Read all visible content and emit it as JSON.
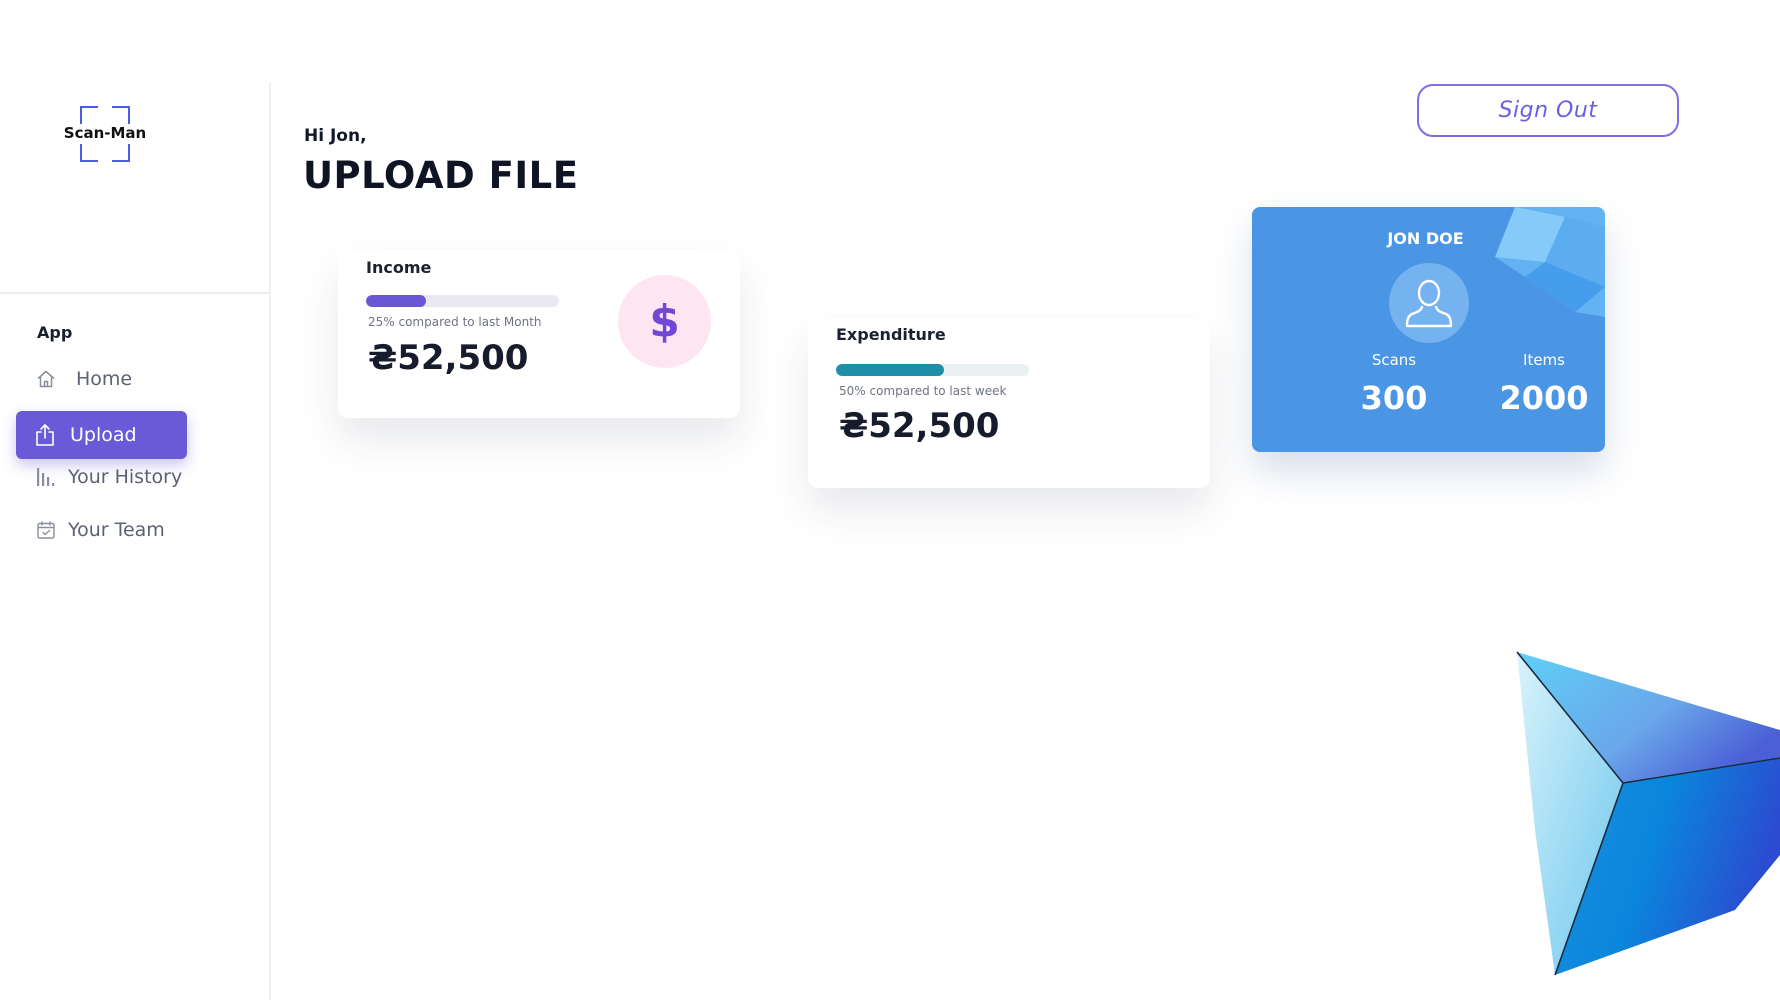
{
  "app": {
    "logo_text": "Scan-Man"
  },
  "sidebar": {
    "section_label": "App",
    "items": [
      {
        "label": "Home",
        "icon": "home-icon",
        "active": false
      },
      {
        "label": "Upload",
        "icon": "upload-icon",
        "active": true
      },
      {
        "label": "Your History",
        "icon": "bar-chart-icon",
        "active": false
      },
      {
        "label": "Your Team",
        "icon": "calendar-check-icon",
        "active": false
      }
    ]
  },
  "header": {
    "greeting": "Hi Jon,",
    "title": "UPLOAD FILE",
    "signout_label": "Sign Out"
  },
  "cards": {
    "income": {
      "title": "Income",
      "progress_percent": 25,
      "comparison": "25% compared to last  Month",
      "amount": "₴52,500",
      "icon": "dollar-icon"
    },
    "expenditure": {
      "title": "Expenditure",
      "progress_percent": 50,
      "comparison": "50% compared to last week",
      "amount": "₴52,500"
    }
  },
  "profile": {
    "name": "JON DOE",
    "avatar_icon": "user-icon",
    "stats": [
      {
        "label": "Scans",
        "value": "300"
      },
      {
        "label": "Items",
        "value": "2000"
      }
    ]
  },
  "colors": {
    "accent": "#6a5ad8",
    "income_bar": "#6a57d3",
    "expenditure_bar": "#1f8fa8",
    "profile_card": "#4a96e5",
    "signout_border": "#7b6ee6"
  }
}
